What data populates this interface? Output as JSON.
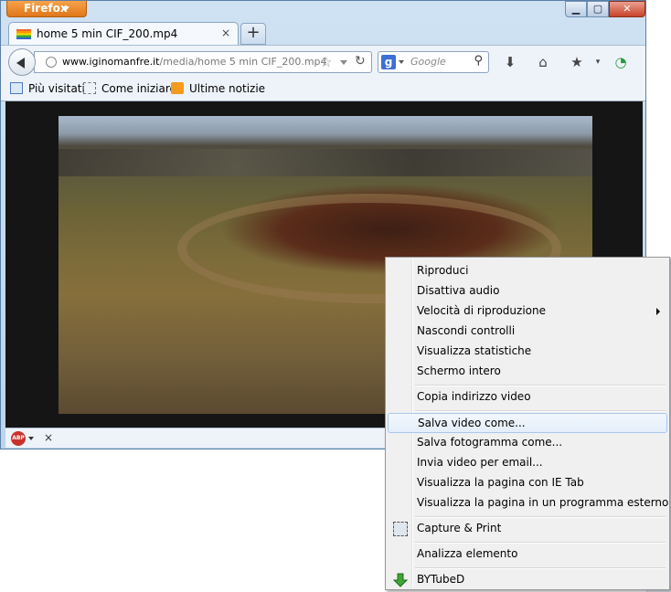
{
  "window": {
    "app_button": "Firefox",
    "controls": {
      "minimize": "▁",
      "maximize": "▢",
      "close": "✕"
    }
  },
  "tab": {
    "title": "home 5 min CIF_200.mp4",
    "close": "×",
    "new_tab": "+"
  },
  "navbar": {
    "url_domain": "www.iginomanfre.it",
    "url_path": "/media/home 5 min CIF_200.mp4",
    "search_engine": "g",
    "search_placeholder": "Google"
  },
  "bookmarks": [
    {
      "label": "Più visitati"
    },
    {
      "label": "Come iniziare"
    },
    {
      "label": "Ultime notizie"
    }
  ],
  "addon_bar": {
    "abp_label": "ABP",
    "close": "×"
  },
  "context_menu": {
    "groups": [
      [
        {
          "label": "Riproduci"
        },
        {
          "label": "Disattiva audio"
        },
        {
          "label": "Velocità di riproduzione",
          "submenu": true
        },
        {
          "label": "Nascondi controlli"
        },
        {
          "label": "Visualizza statistiche"
        },
        {
          "label": "Schermo intero"
        }
      ],
      [
        {
          "label": "Copia indirizzo video"
        }
      ],
      [
        {
          "label": "Salva video come...",
          "highlighted": true
        },
        {
          "label": "Salva fotogramma come..."
        },
        {
          "label": "Invia video per email..."
        },
        {
          "label": "Visualizza la pagina con IE Tab"
        },
        {
          "label": "Visualizza la pagina in un programma esterno (X)"
        }
      ],
      [
        {
          "label": "Capture & Print",
          "icon": "capture-icon"
        }
      ],
      [
        {
          "label": "Analizza elemento"
        }
      ],
      [
        {
          "label": "BYTubeD",
          "icon": "bytubed-icon"
        }
      ]
    ]
  },
  "colors": {
    "firefox_orange": "#e0761a",
    "menu_highlight_border": "#a8c8ec",
    "frame_blue": "#bcd3ea"
  }
}
